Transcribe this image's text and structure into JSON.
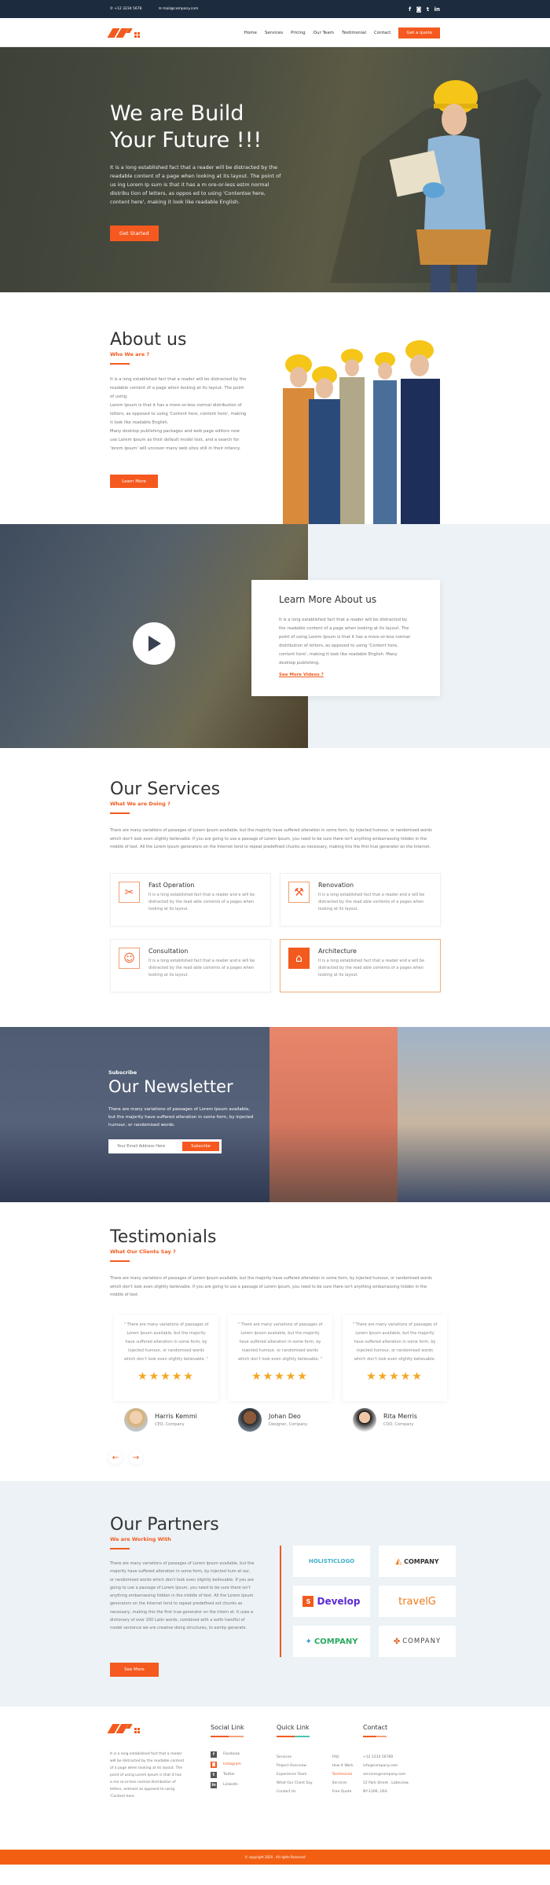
{
  "topbar": {
    "phone": "+12 3234 5678",
    "email": "mail@company.com",
    "social": [
      "f",
      "◙",
      "t",
      "in"
    ]
  },
  "nav": {
    "items": [
      "Home",
      "Services",
      "Pricing",
      "Our Team",
      "Testimonial",
      "Contact"
    ],
    "cta": "Get a quote"
  },
  "hero": {
    "title_line1": "We are Build",
    "title_line2": "Your Future !!!",
    "text": "It is a long established fact that a reader will be distracted by the readable content of a page when looking at its layout. The point of us ing Lorem Ip sum is that it has a m ore-or-less estm normal distribu tion of letters, as oppos ed to using 'Contentse here, content here', making it look like readable English.",
    "button": "Get Started"
  },
  "about": {
    "title": "About us",
    "subtitle": "Who We are ?",
    "paragraphs": [
      "It is a long established fact that a reader will be distracted by the readable content of a page when looking at its layout. The point of using.",
      "Lorem Ipsum is that it has a more-or-less normal distribution of letters, as opposed to using 'Content here, content here', making it look like readable English.",
      "Many desktop publishing packages and web page editors now use Lorem Ipsum as their default model text, and a search for 'lorem ipsum' will uncover many web sites still in their infancy."
    ],
    "button": "Learn More"
  },
  "video": {
    "title": "Learn More About us",
    "text": "It is a long established fact that a reader will be distracted by the readable content of a page when looking at its layout. The point of using Lorem Ipsum is that it has a more-or-less normal distribution of letters, as opposed to using 'Content here, content here', making it look like readable English. Many desktop publishing.",
    "link": "See More Videos ?"
  },
  "services": {
    "title": "Our Services",
    "subtitle": "What We are Doing ?",
    "intro": "There are many variations of passages of Lorem Ipsum available, but the majority have suffered alteration in some form, by injected humour, or randomised words which don't look even slightly believable. If you are going to use a passage of Lorem Ipsum, you need to be sure there isn't anything embarrassing hidden in the middle of text. All the Lorem Ipsum generators on the Internet tend to repeat predefined chunks as necessary, making this the first true generator on the Internet.",
    "items": [
      {
        "title": "Fast Operation",
        "text": "It is a long established fact that a reader and e will be distracted by the read able contents of a pages when looking at its layout.",
        "icon": "✂"
      },
      {
        "title": "Renovation",
        "text": "It is a long established fact that a reader and e will be distracted by the read able contents of a pages when looking at its layout.",
        "icon": "⚒"
      },
      {
        "title": "Consultation",
        "text": "It is a long established fact that a reader and e will be distracted by the read able contents of a pages when looking at its layout.",
        "icon": "☺"
      },
      {
        "title": "Architecture",
        "text": "It is a long established fact that a reader and e will be distracted by the read able contents of a pages when looking at its layout.",
        "icon": "⌂"
      }
    ]
  },
  "newsletter": {
    "small": "Subscribe",
    "title": "Our Newsletter",
    "text": "There are many variations of passages of Lorem Ipsum available, but the majority have suffered alteration in some form, by injected humour, or randomised words.",
    "placeholder": "Your Email Address Here",
    "button": "Subscribe"
  },
  "testimonials": {
    "title": "Testimonials",
    "subtitle": "What Our Clients Say ?",
    "intro": "There are many variations of passages of Lorem Ipsum available, but the majority have suffered alteration in some form, by injected humour, or randomised words which don't look even slightly believable. If you are going to use a passage of Lorem Ipsum, you need to be sure there isn't anything embarrassing hidden in the middle of text.",
    "items": [
      {
        "quote": "\" There are many variations of passages of Lorem Ipsum available, but the majority have suffered alteration in some form, by injected humour, or randomised words which don't look even slightly believable. \"",
        "stars": "★★★★★",
        "name": "Harris Kemmi",
        "role": "CEO, Company"
      },
      {
        "quote": "\" There are many variations of passages of Lorem Ipsum available, but the majority have suffered alteration in some form, by injected humour, or randomised words which don't look even slightly believable. \"",
        "stars": "★★★★★",
        "name": "Johan Deo",
        "role": "Designer, Company"
      },
      {
        "quote": "\" There are many variations of passages of Lorem Ipsum available, but the majority have suffered alteration in some form, by injected humour, or randomised words which don't look even slightly believable.",
        "stars": "★★★★★",
        "name": "Rita Merris",
        "role": "COO, Company"
      }
    ],
    "prev": "←",
    "next": "→"
  },
  "partners": {
    "title": "Our Partners",
    "subtitle": "We are Working With",
    "text": "There are many variations of passages of Lorem Ipsum available, but the majority have suffered alteration in some form, by injected hum et our, or randomised words which don't look even slightly believable. If you are going to use a passage of Lorem Ipsum, you need to be sure there isn't anything embarrassing hidden in the middle of text. All the Lorem Ipsum generators on the Internet tend to repeat predefined est chunks as necessary, making this the first true generator on the Intern et. It uses a dictionary of over 200 Latin words, combined with a estfo handful of model sentence we are creative doing structures, to esmtp generate.",
    "button": "See More",
    "logos": [
      {
        "name": "HOLISTICLOGO",
        "color": "#3fb0c8"
      },
      {
        "name": "COMPANY",
        "color": "#333333"
      },
      {
        "name": "Develop",
        "color": "#5b2bd6"
      },
      {
        "name": "travelG",
        "color": "#f07a1a"
      },
      {
        "name": "COMPANY",
        "color": "#2aa860"
      },
      {
        "name": "COMPANY",
        "color": "#444444"
      }
    ]
  },
  "footer": {
    "about": "It is a long established fact that a reader will be distracted by the readable content of a page when looking at its layout. The point of using Lorem Ipsum is that it has a mo re-or-less normal distribution of letters, estmest as opposed to using 'Content here.",
    "social_title": "Social Link",
    "social": [
      {
        "icon": "f",
        "label": "Facebook"
      },
      {
        "icon": "◙",
        "label": "Instagram"
      },
      {
        "icon": "t",
        "label": "Twitter"
      },
      {
        "icon": "in",
        "label": "LinkedIn"
      }
    ],
    "quick_title": "Quick Link",
    "quick_col1": [
      "Services",
      "Project Overview",
      "Experience Team",
      "What Our Client Say",
      "Contact Us"
    ],
    "quick_col2": [
      "FAQ",
      "How it Work",
      "Testimonial",
      "Services",
      "Free Quote"
    ],
    "contact_title": "Contact",
    "contact": [
      "+12 1234 56789",
      "info@company.com",
      "services@company.com",
      "12 Park Street , Labeview,",
      "NY-1206, USA"
    ],
    "copyright": "© copyright 2020 . All rights Reserved"
  },
  "colors": {
    "accent": "#f5591f",
    "dark": "#1d2b3f",
    "light_bg": "#ecf2f5",
    "star": "#f5a623"
  }
}
